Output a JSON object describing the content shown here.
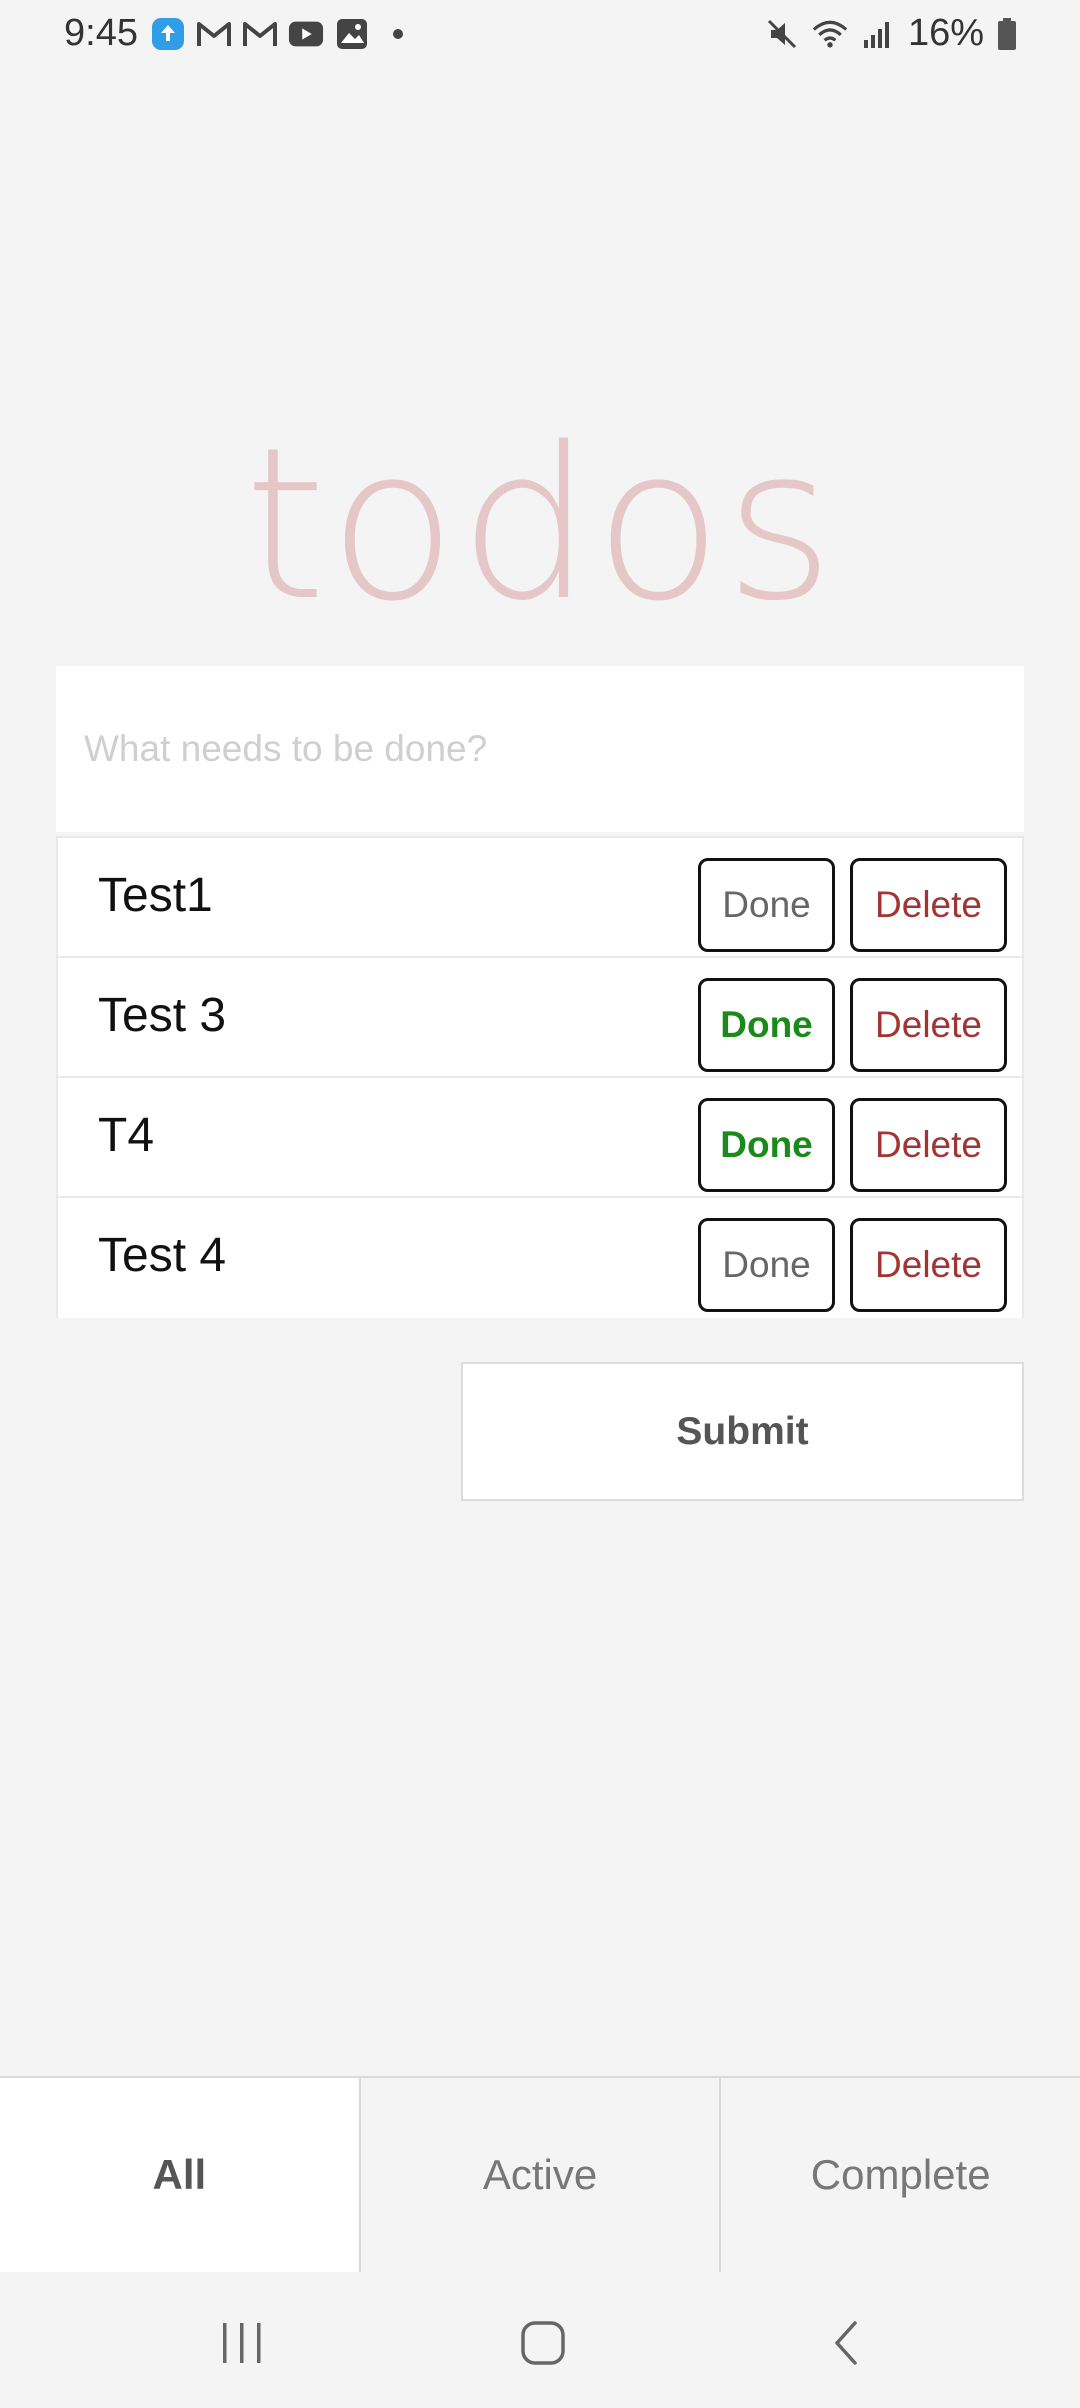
{
  "status_bar": {
    "time": "9:45",
    "battery": "16%",
    "left_icons": [
      "cloud-upload-icon",
      "gmail-icon",
      "gmail-icon",
      "youtube-icon",
      "gallery-icon",
      "dot-icon"
    ],
    "right_icons": [
      "mute-icon",
      "wifi-icon",
      "signal-icon",
      "battery-icon"
    ]
  },
  "app": {
    "title": "todos",
    "input": {
      "placeholder": "What needs to be done?",
      "value": ""
    },
    "todos": [
      {
        "label": "Test1",
        "done_label": "Done",
        "delete_label": "Delete",
        "completed": false
      },
      {
        "label": "Test 3",
        "done_label": "Done",
        "delete_label": "Delete",
        "completed": true
      },
      {
        "label": "T4",
        "done_label": "Done",
        "delete_label": "Delete",
        "completed": true
      },
      {
        "label": "Test 4",
        "done_label": "Done",
        "delete_label": "Delete",
        "completed": false
      }
    ],
    "submit_label": "Submit",
    "filters": [
      {
        "label": "All",
        "active": true
      },
      {
        "label": "Active",
        "active": false
      },
      {
        "label": "Complete",
        "active": false
      }
    ]
  },
  "colors": {
    "title": "#e6c7c7",
    "done_complete": "#1a8a1a",
    "delete": "#a33434",
    "background": "#f4f4f4"
  },
  "nav_bar": {
    "icons": [
      "recent-apps-icon",
      "home-icon",
      "back-icon"
    ]
  }
}
